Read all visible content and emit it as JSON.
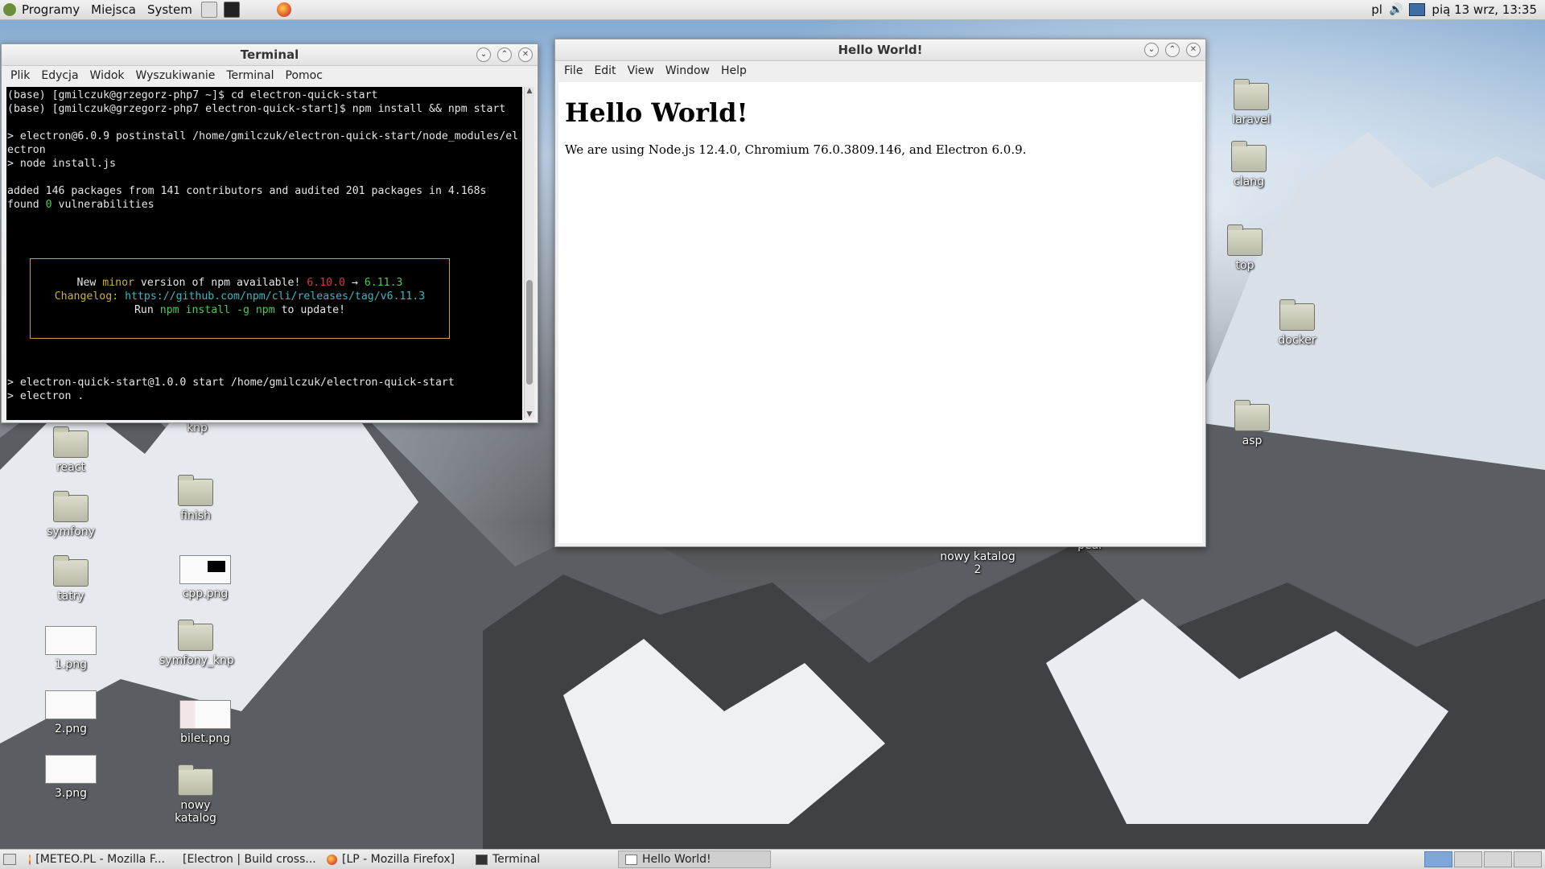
{
  "top_panel": {
    "menus": [
      "Programy",
      "Miejsca",
      "System"
    ],
    "keyboard_layout": "pl",
    "clock": "pią 13 wrz, 13:35"
  },
  "terminal": {
    "title": "Terminal",
    "menu": [
      "Plik",
      "Edycja",
      "Widok",
      "Wyszukiwanie",
      "Terminal",
      "Pomoc"
    ],
    "lines": {
      "l1": "(base) [gmilczuk@grzegorz-php7 ~]$ cd electron-quick-start",
      "l2": "(base) [gmilczuk@grzegorz-php7 electron-quick-start]$ npm install && npm start",
      "l3": "> electron@6.0.9 postinstall /home/gmilczuk/electron-quick-start/node_modules/el",
      "l4": "ectron",
      "l5": "> node install.js",
      "l6": "added 146 packages from 141 contributors and audited 201 packages in 4.168s",
      "l7_a": "found ",
      "l7_b": "0",
      "l7_c": " vulnerabilities",
      "l8": "> electron-quick-start@1.0.0 start /home/gmilczuk/electron-quick-start",
      "l9": "> electron ."
    },
    "npm_notice": {
      "new_text": "New ",
      "minor": "minor",
      "version_text": " version of npm available! ",
      "old_version": "6.10.0",
      "arrow": " → ",
      "new_version": "6.11.3",
      "changelog_label": "Changelog: ",
      "changelog_url": "https://github.com/npm/cli/releases/tag/v6.11.3",
      "run_text": "Run ",
      "command": "npm install -g npm",
      "update_text": " to update!"
    }
  },
  "electron": {
    "title": "Hello World!",
    "menu": [
      "File",
      "Edit",
      "View",
      "Window",
      "Help"
    ],
    "heading": "Hello World!",
    "body": "We are using Node.js 12.4.0, Chromium 76.0.3809.146, and Electron 6.0.9."
  },
  "desktop_icons": {
    "knp": "knp",
    "react": "react",
    "symfony": "symfony",
    "finish": "finish",
    "tatry": "tatry",
    "cpp_png": "cpp.png",
    "png1": "1.png",
    "symfony_knp": "symfony_knp",
    "png2": "2.png",
    "bilet": "bilet.png",
    "png3": "3.png",
    "nowy_katalog": "nowy katalog",
    "nowy_katalog_2": "nowy katalog 2",
    "pear": "pear",
    "laravel": "laravel",
    "clang": "clang",
    "top": "top",
    "docker": "docker",
    "asp": "asp"
  },
  "taskbar": {
    "items": [
      "[METEO.PL - Mozilla F...",
      "[Electron | Build cross...",
      "[LP - Mozilla Firefox]",
      "Terminal",
      "Hello World!"
    ]
  }
}
